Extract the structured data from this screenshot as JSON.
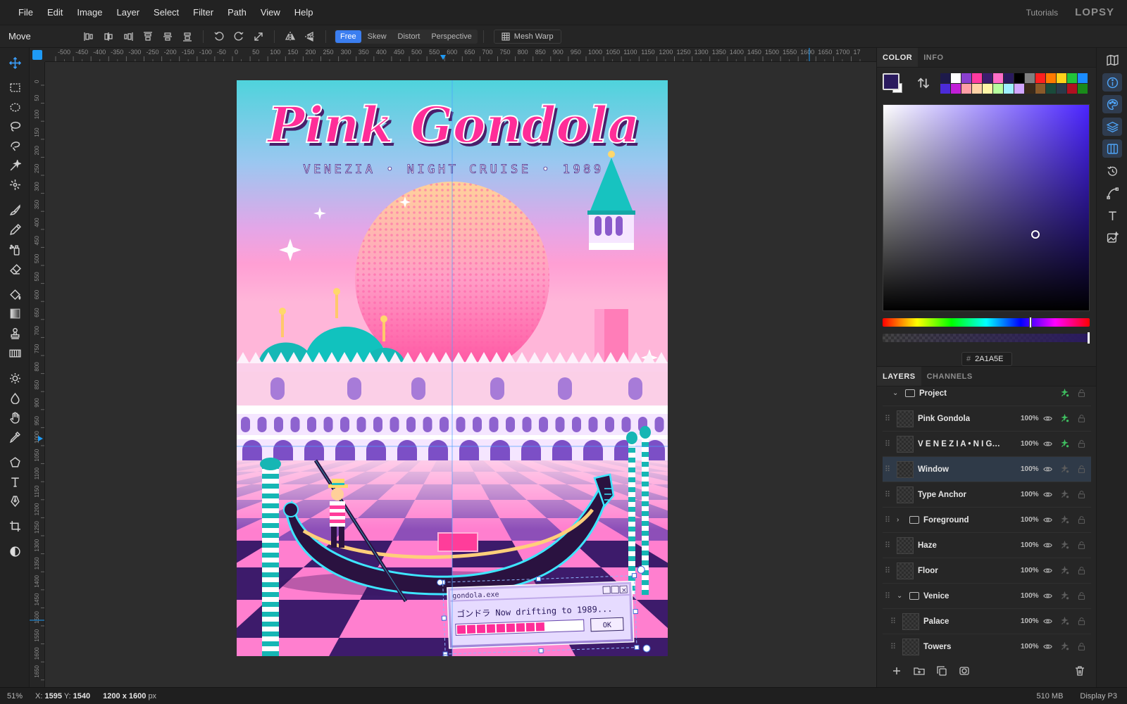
{
  "menubar": {
    "items": [
      "File",
      "Edit",
      "Image",
      "Layer",
      "Select",
      "Filter",
      "Path",
      "View",
      "Help"
    ],
    "tutorials": "Tutorials",
    "brand": "LOPSY"
  },
  "options": {
    "tool_name": "Move",
    "modes": [
      "Free",
      "Skew",
      "Distort",
      "Perspective"
    ],
    "active_mode": "Free",
    "mesh_warp": "Mesh Warp"
  },
  "rulers": {
    "horizontal": [
      "-500",
      "-450",
      "-400",
      "-350",
      "-300",
      "-250",
      "-200",
      "-150",
      "-100",
      "-50",
      "0",
      "50",
      "100",
      "150",
      "200",
      "250",
      "300",
      "350",
      "400",
      "450",
      "500",
      "550",
      "600",
      "650",
      "700",
      "750",
      "800",
      "850",
      "900",
      "950",
      "1000",
      "1050",
      "1100",
      "1150",
      "1200",
      "1250",
      "1300",
      "1350",
      "1400",
      "1450",
      "1500",
      "1550",
      "1600",
      "1650",
      "1700",
      "17"
    ],
    "vertical": [
      "0",
      "50",
      "100",
      "150",
      "200",
      "250",
      "300",
      "350",
      "400",
      "450",
      "500",
      "550",
      "600",
      "650",
      "700",
      "750",
      "800",
      "850",
      "900",
      "950",
      "1000",
      "1050",
      "1100",
      "1150",
      "1200",
      "1250",
      "1300",
      "1350",
      "1400",
      "1450",
      "1500",
      "1550",
      "1600",
      "1650"
    ]
  },
  "artwork": {
    "title": "Pink Gondola",
    "subtitle": "VENEZIA • NIGHT CRUISE • 1989",
    "dialog": {
      "title": "gondola.exe",
      "message": "ゴンドラ  Now drifting to 1989...",
      "ok": "OK",
      "progress": 0.72
    }
  },
  "color_panel": {
    "tabs": [
      "COLOR",
      "INFO"
    ],
    "active_tab": "COLOR",
    "foreground": "#2A1A5E",
    "background": "#FFFFFF",
    "hex": "2A1A5E",
    "hash": "#",
    "palette": [
      "#1d1a4a",
      "#ffffff",
      "#8a3fcf",
      "#ff3aa0",
      "#3b1d6e",
      "#ff6ec7",
      "#2a1a5e",
      "#000000",
      "#808080",
      "#ff1f1f",
      "#ff7a00",
      "#ffd21a",
      "#21c43a",
      "#1a8cff",
      "#4b2bd8",
      "#c21fd8",
      "#ff9ea6",
      "#ffd2a6",
      "#fff5a6",
      "#b6ff9e",
      "#9ef0ff",
      "#d1a6ff",
      "#3a2a1a",
      "#8a5a2a",
      "#1a4a3a",
      "#2a3a4a",
      "#b01020",
      "#1a8a1a"
    ]
  },
  "layers_panel": {
    "tabs": [
      "LAYERS",
      "CHANNELS"
    ],
    "active_tab": "LAYERS",
    "rows": [
      {
        "name": "Project",
        "kind": "group-root",
        "opacity": ""
      },
      {
        "name": "Pink Gondola",
        "kind": "layer",
        "opacity": "100%",
        "fx": true
      },
      {
        "name": "V E N E Z I A  •  N I G H T",
        "kind": "layer",
        "opacity": "100%",
        "fx": true
      },
      {
        "name": "Window",
        "kind": "layer",
        "opacity": "100%",
        "selected": true
      },
      {
        "name": "Type Anchor",
        "kind": "layer",
        "opacity": "100%"
      },
      {
        "name": "Foreground",
        "kind": "folder-collapsed",
        "opacity": "100%"
      },
      {
        "name": "Haze",
        "kind": "layer",
        "opacity": "100%"
      },
      {
        "name": "Floor",
        "kind": "layer",
        "opacity": "100%"
      },
      {
        "name": "Venice",
        "kind": "folder-expanded",
        "opacity": "100%"
      },
      {
        "name": "Palace",
        "kind": "child",
        "opacity": "100%"
      },
      {
        "name": "Towers",
        "kind": "child",
        "opacity": "100%"
      }
    ]
  },
  "status": {
    "zoom": "51%",
    "x_label": "X:",
    "x": "1595",
    "y_label": "Y:",
    "y": "1540",
    "width": "1200",
    "height": "1600",
    "dim_sep": "x",
    "unit": "px",
    "memory": "510 MB",
    "profile": "Display P3"
  }
}
